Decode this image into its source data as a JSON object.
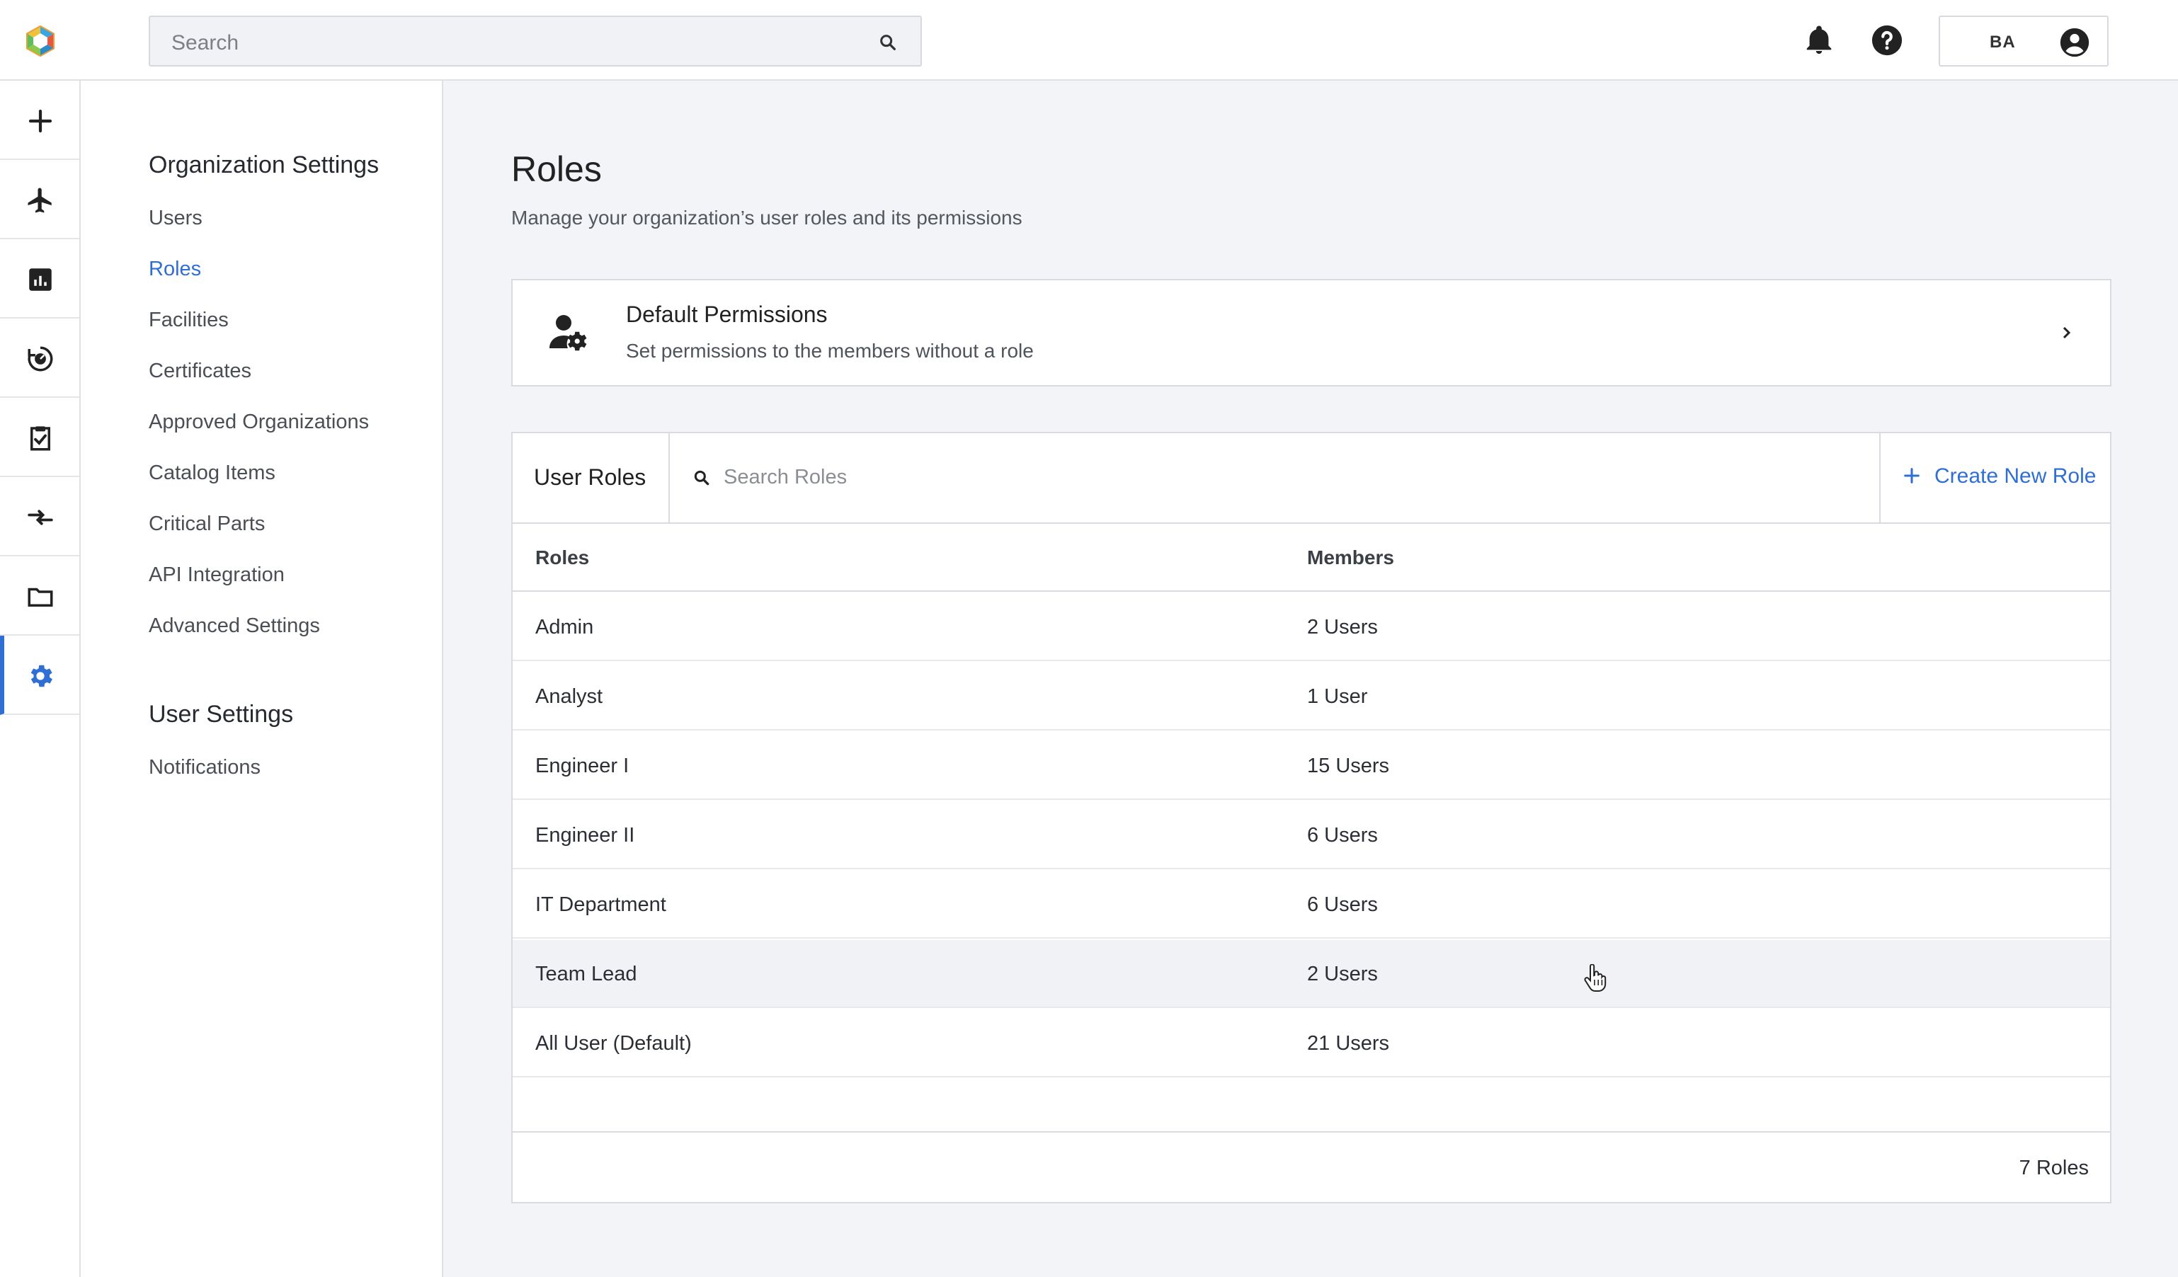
{
  "topbar": {
    "search_placeholder": "Search",
    "user_initials": "BA"
  },
  "rail": {
    "items": [
      "add-icon",
      "airplane-icon",
      "chart-icon",
      "analytics-icon",
      "clipboard-check-icon",
      "transfer-icon",
      "folder-icon",
      "gear-icon"
    ],
    "active": "gear-icon"
  },
  "nav": {
    "org_heading": "Organization Settings",
    "org_items": [
      "Users",
      "Roles",
      "Facilities",
      "Certificates",
      "Approved Organizations",
      "Catalog Items",
      "Critical Parts",
      "API Integration",
      "Advanced Settings"
    ],
    "active_item": "Roles",
    "user_heading": "User Settings",
    "user_items": [
      "Notifications"
    ]
  },
  "page": {
    "title": "Roles",
    "subtitle": "Manage your organization’s user roles and its permissions"
  },
  "default_permissions": {
    "title": "Default Permissions",
    "description": "Set permissions to the members without a role"
  },
  "roles_table": {
    "tab_label": "User Roles",
    "search_placeholder": "Search Roles",
    "create_label": "Create New Role",
    "columns": [
      "Roles",
      "Members"
    ],
    "rows": [
      {
        "role": "Admin",
        "members": "2 Users"
      },
      {
        "role": "Analyst",
        "members": "1 User"
      },
      {
        "role": "Engineer I",
        "members": "15 Users"
      },
      {
        "role": "Engineer II",
        "members": "6 Users"
      },
      {
        "role": "IT Department",
        "members": "6 Users"
      },
      {
        "role": "Team Lead",
        "members": "2 Users"
      },
      {
        "role": "All User (Default)",
        "members": "21 Users"
      }
    ],
    "hovered_row": "Team Lead",
    "footer_count": "7 Roles"
  },
  "colors": {
    "accent": "#2f6fd4",
    "background": "#f3f4f7"
  }
}
